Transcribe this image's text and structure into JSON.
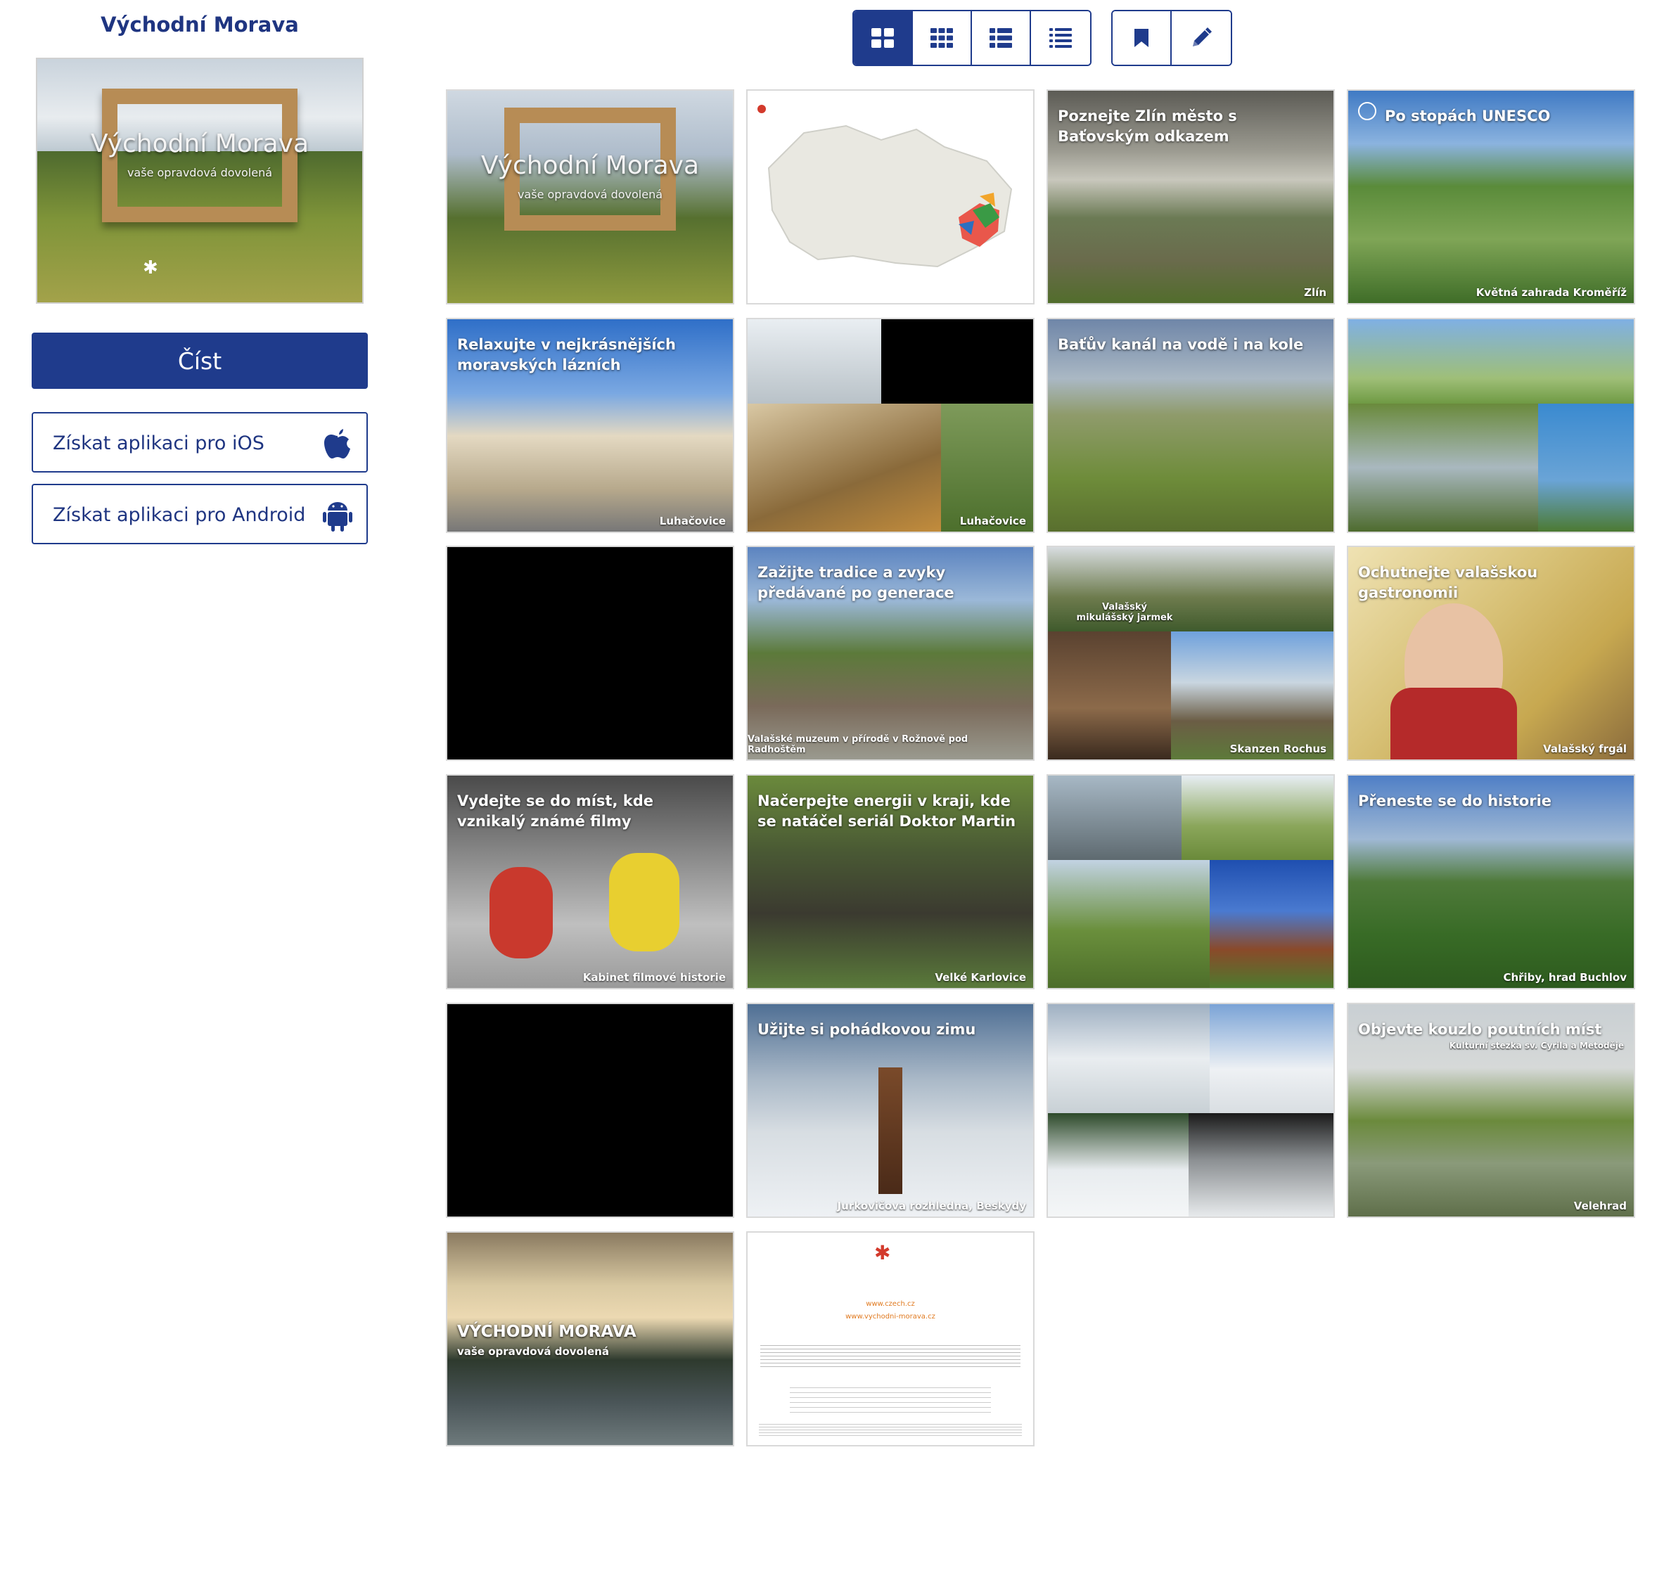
{
  "sidebar": {
    "title": "Východní Morava",
    "cover": {
      "title": "Východní Morava",
      "subtitle": "vaše opravdová dovolená"
    },
    "read_button": "Číst",
    "ios_button": "Získat aplikaci pro iOS",
    "android_button": "Získat aplikaci pro Android"
  },
  "toolbar": {
    "view_buttons": [
      "grid-large-icon",
      "grid-small-icon",
      "list-icon",
      "list-detailed-icon"
    ],
    "action_buttons": [
      "bookmark-icon",
      "pencil-icon"
    ]
  },
  "pages": [
    {
      "title": "Východní Morava",
      "subtitle": "vaše opravdová dovolená"
    },
    {
      "title": ""
    },
    {
      "title": "Poznejte Zlín město s Baťovským odkazem",
      "caption": "Zlín"
    },
    {
      "title": "Po stopách UNESCO",
      "caption": "Květná zahrada Kroměříž"
    },
    {
      "title": "Relaxujte v nejkrásnějších moravských lázních",
      "caption": "Luhačovice"
    },
    {
      "title": "",
      "caption": "Luhačovice"
    },
    {
      "title": "Baťův kanál na vodě i na kole"
    },
    {
      "title": ""
    },
    {
      "title": ""
    },
    {
      "title": "Zažijte tradice a zvyky předávané po generace",
      "caption": "Valašské muzeum v přírodě v Rožnově pod Radhoštěm"
    },
    {
      "title": "Valašský mikulášský jarmek",
      "caption": "Skanzen Rochus"
    },
    {
      "title": "Ochutnejte valašskou gastronomii",
      "caption": "Valašský frgál"
    },
    {
      "title": "Vydejte se do míst, kde vznikalý známé filmy",
      "caption": "Kabinet filmové historie"
    },
    {
      "title": "Načerpejte energii v kraji, kde se natáčel seriál Doktor Martin",
      "caption": "Velké Karlovice"
    },
    {
      "title": ""
    },
    {
      "title": "Přeneste se do historie",
      "caption": "Chřiby, hrad Buchlov"
    },
    {
      "title": ""
    },
    {
      "title": "Užijte si pohádkovou zimu",
      "caption": "Jurkovičova rozhledna, Beskydy"
    },
    {
      "title": ""
    },
    {
      "title": "Objevte kouzlo poutních míst",
      "subtitle": "Kulturní stezka sv. Cyrila a Metoděje",
      "caption": "Velehrad"
    },
    {
      "title": "VÝCHODNÍ MORAVA",
      "subtitle": "vaše opravdová dovolená"
    },
    {
      "title": "",
      "links": [
        "www.czech.cz",
        "www.vychodni-morava.cz"
      ]
    }
  ],
  "colors": {
    "accent": "#1f3b8c",
    "title": "#1f3581"
  }
}
